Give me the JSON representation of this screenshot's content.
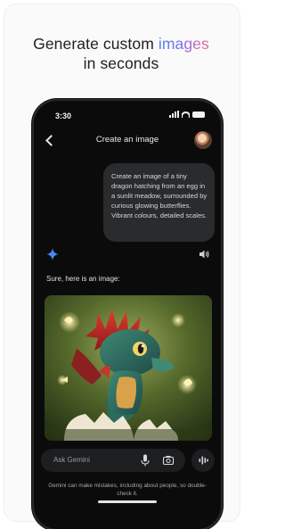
{
  "promo": {
    "headline_line1_pre": "Generate custom ",
    "headline_accent": "images",
    "headline_line2": "in seconds"
  },
  "status_bar": {
    "time": "3:30"
  },
  "chat": {
    "title": "Create an image",
    "user_prompt": "Create an image of a tiny dragon hatching from an egg in a sunlit meadow, surrounded by curious glowing butterflies. Vibrant colours, detailed scales.",
    "assistant_reply": "Sure, here is an image:"
  },
  "composer": {
    "placeholder": "Ask Gemini",
    "disclaimer": "Gemini can make mistakes, including about people, so double-check it."
  },
  "icons": {
    "back": "chevron-left-icon",
    "avatar": "avatar",
    "assistant": "gemini-spark-icon",
    "read_aloud": "speaker-icon",
    "mic": "mic-icon",
    "camera": "camera-icon",
    "live": "live-waveform-icon"
  },
  "colors": {
    "phone_bg": "#0b0b0c",
    "bubble_bg": "#2a2b2d",
    "spark": "#4a86f0",
    "accent_gradient": [
      "#4f7ff0",
      "#7b6ff0",
      "#c56ab9",
      "#e0708a"
    ]
  }
}
